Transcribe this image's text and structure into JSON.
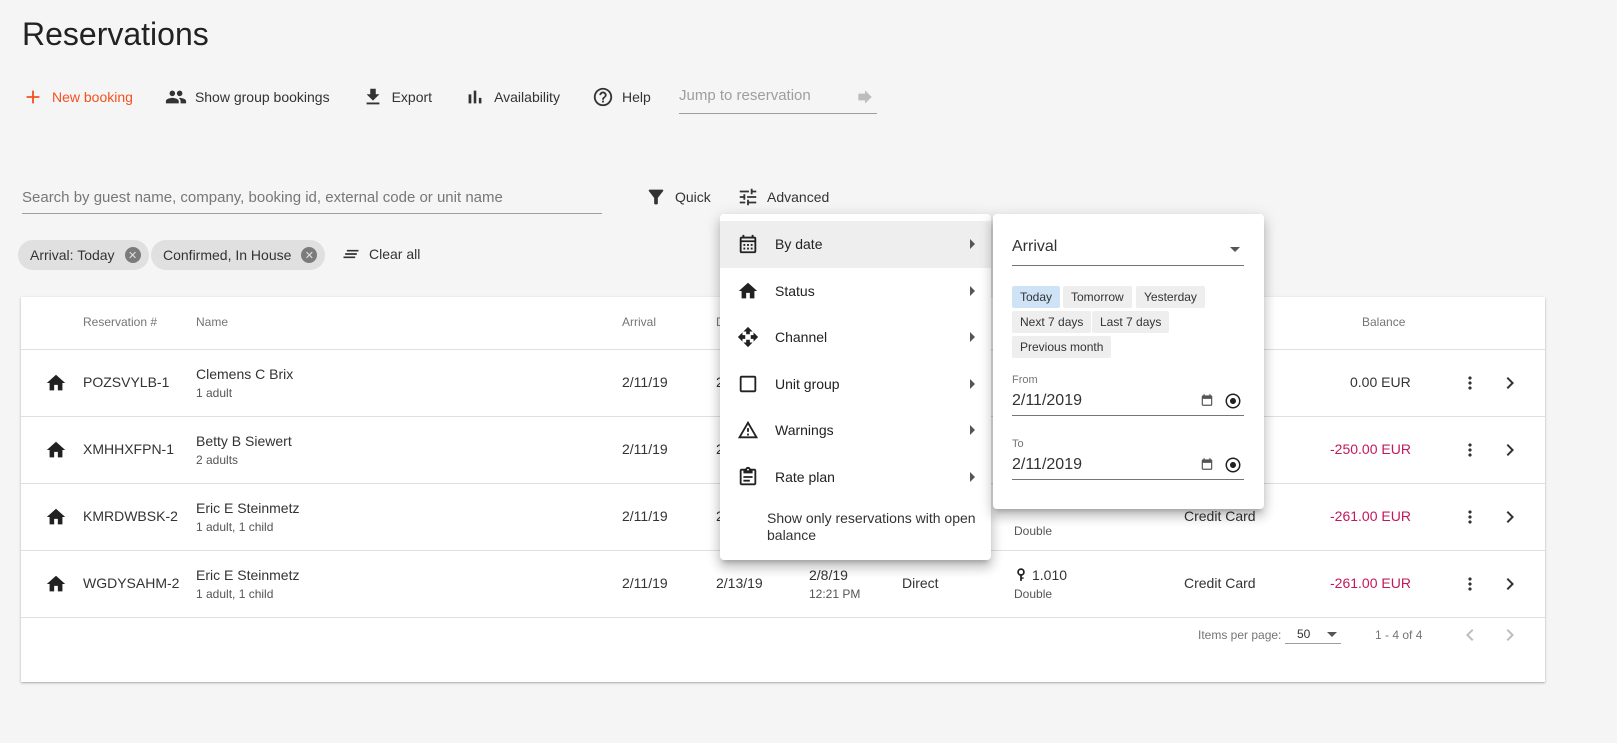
{
  "page": {
    "title": "Reservations"
  },
  "toolbar": {
    "new_booking": "New booking",
    "show_group": "Show group bookings",
    "export": "Export",
    "availability": "Availability",
    "help": "Help",
    "jump_placeholder": "Jump to reservation"
  },
  "search": {
    "placeholder": "Search by guest name, company, booking id, external code or unit name"
  },
  "filters": {
    "quick": "Quick",
    "advanced": "Advanced"
  },
  "chips": [
    "Arrival: Today",
    "Confirmed, In House"
  ],
  "clear_all": "Clear all",
  "table": {
    "headers": {
      "reservation": "Reservation #",
      "name": "Name",
      "arrival": "Arrival",
      "departure": "D",
      "balance": "Balance"
    },
    "rows": [
      {
        "id": "POZSVYLB-1",
        "name": "Clemens C Brix",
        "guests": "1  adult",
        "arrival": "2/11/19",
        "departure": "2",
        "created": "",
        "created_time": "",
        "channel": "",
        "unit": "",
        "unit_group": "",
        "payment": "",
        "balance": "0.00 EUR",
        "negative": false
      },
      {
        "id": "XMHHXFPN-1",
        "name": "Betty B Siewert",
        "guests": "2  adults",
        "arrival": "2/11/19",
        "departure": "2",
        "created": "",
        "created_time": "",
        "channel": "",
        "unit": "",
        "unit_group": "",
        "payment": "",
        "balance": "-250.00 EUR",
        "negative": true
      },
      {
        "id": "KMRDWBSK-2",
        "name": "Eric E Steinmetz",
        "guests": "1  adult,  1  child",
        "arrival": "2/11/19",
        "departure": "2",
        "created": "",
        "created_time": "",
        "channel": "",
        "unit": "",
        "unit_group": "Double",
        "payment": "Credit Card",
        "balance": "-261.00 EUR",
        "negative": true
      },
      {
        "id": "WGDYSAHM-2",
        "name": "Eric E Steinmetz",
        "guests": "1  adult,  1  child",
        "arrival": "2/11/19",
        "departure": "2/13/19",
        "created": "2/8/19",
        "created_time": "12:21 PM",
        "channel": "Direct",
        "unit": "1.010",
        "unit_group": "Double",
        "payment": "Credit Card",
        "balance": "-261.00 EUR",
        "negative": true
      }
    ],
    "footer": {
      "items_per_page_label": "Items per page:",
      "items_per_page": "50",
      "range": "1 - 4 of 4"
    }
  },
  "advanced_menu": {
    "items": [
      {
        "label": "By date",
        "icon": "calendar-icon"
      },
      {
        "label": "Status",
        "icon": "home-icon"
      },
      {
        "label": "Channel",
        "icon": "channel-icon"
      },
      {
        "label": "Unit group",
        "icon": "square-icon"
      },
      {
        "label": "Warnings",
        "icon": "warning-icon"
      },
      {
        "label": "Rate plan",
        "icon": "clipboard-icon"
      }
    ],
    "open_balance": "Show only reservations with open balance"
  },
  "date_panel": {
    "type": "Arrival",
    "quick": [
      "Today",
      "Tomorrow",
      "Yesterday",
      "Next 7 days",
      "Last 7 days",
      "Previous month"
    ],
    "active_quick": "Today",
    "from_label": "From",
    "from_value": "2/11/2019",
    "to_label": "To",
    "to_value": "2/11/2019"
  },
  "colors": {
    "accent": "#f4511e",
    "negative": "#c2185b",
    "active_chip": "#cfe3f7"
  }
}
